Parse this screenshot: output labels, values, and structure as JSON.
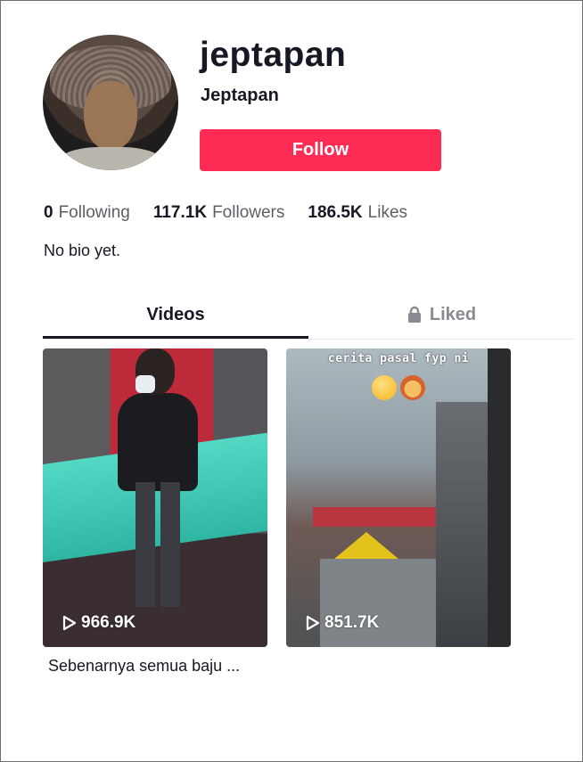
{
  "profile": {
    "username": "jeptapan",
    "nickname": "Jeptapan",
    "follow_label": "Follow",
    "bio": "No bio yet."
  },
  "stats": [
    {
      "value": "0",
      "label": "Following"
    },
    {
      "value": "117.1K",
      "label": "Followers"
    },
    {
      "value": "186.5K",
      "label": "Likes"
    }
  ],
  "tabs": [
    {
      "label": "Videos",
      "active": true
    },
    {
      "label": "Liked",
      "icon": "lock-icon"
    }
  ],
  "videos": [
    {
      "views": "966.9K",
      "caption": "Sebenarnya semua baju ..."
    },
    {
      "views": "851.7K",
      "overlay_text": "cerita pasal fyp ni",
      "emojis": [
        "dizzy-face-emoji",
        "lion-emoji"
      ]
    }
  ],
  "colors": {
    "follow_button": "#fe2c55",
    "text_primary": "#161823",
    "text_secondary": "#5e5f66",
    "tab_inactive": "#8a8b91"
  }
}
